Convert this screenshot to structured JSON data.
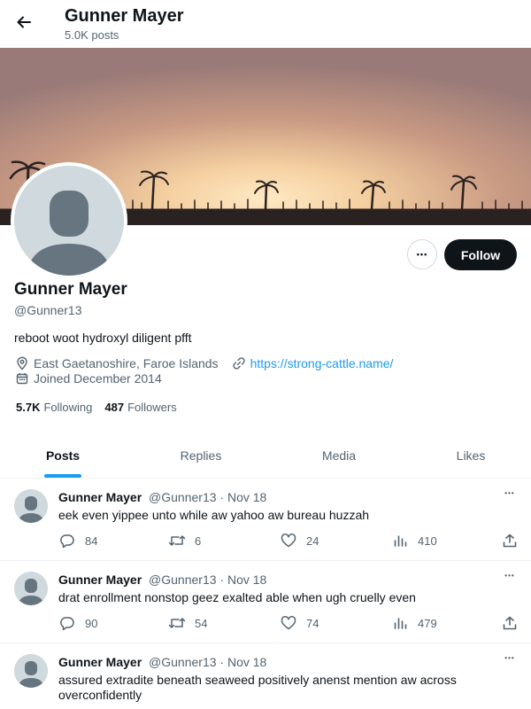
{
  "header": {
    "name": "Gunner Mayer",
    "post_count": "5.0K posts"
  },
  "profile": {
    "name": "Gunner Mayer",
    "handle": "@Gunner13",
    "bio": "reboot woot hydroxyl diligent pfft",
    "location": "East Gaetanoshire, Faroe Islands",
    "website": "https://strong-cattle.name/",
    "joined": "Joined December 2014",
    "following_count": "5.7K",
    "following_label": "Following",
    "followers_count": "487",
    "followers_label": "Followers",
    "follow_label": "Follow",
    "more_label": "•••"
  },
  "tabs": [
    {
      "label": "Posts"
    },
    {
      "label": "Replies"
    },
    {
      "label": "Media"
    },
    {
      "label": "Likes"
    }
  ],
  "posts": [
    {
      "name": "Gunner Mayer",
      "handle": "@Gunner13",
      "date": "· Nov 18",
      "text": "eek even yippee unto while aw yahoo aw bureau huzzah",
      "replies": "84",
      "reposts": "6",
      "likes": "24",
      "views": "410"
    },
    {
      "name": "Gunner Mayer",
      "handle": "@Gunner13",
      "date": "· Nov 18",
      "text": "drat enrollment nonstop geez exalted able when ugh cruelly even",
      "replies": "90",
      "reposts": "54",
      "likes": "74",
      "views": "479"
    },
    {
      "name": "Gunner Mayer",
      "handle": "@Gunner13",
      "date": "· Nov 18",
      "text": "assured extradite beneath seaweed positively anenst mention aw across overconfidently"
    }
  ],
  "post_more_label": "•••",
  "colors": {
    "accent": "#1d9bf0",
    "text": "#0f1419",
    "muted": "#536471",
    "follow_bg": "#0f1419"
  }
}
